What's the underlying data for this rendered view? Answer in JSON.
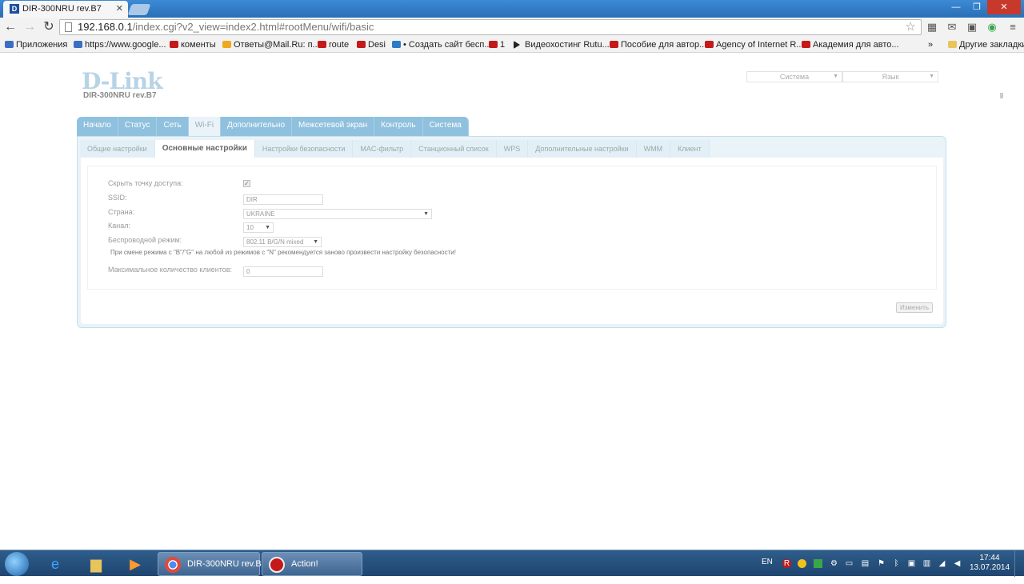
{
  "browser": {
    "tab_title": "DIR-300NRU rev.B7",
    "tab_favicon_letter": "D",
    "url_host": "192.168.0.1",
    "url_path": "/index.cgi?v2_view=index2.html#rootMenu/wifi/basic"
  },
  "bookmarks": [
    {
      "label": "Приложения",
      "icon": "apps-grid-icon"
    },
    {
      "label": "https://www.google...",
      "icon": "google-icon"
    },
    {
      "label": "коменты",
      "icon": "youtube-icon"
    },
    {
      "label": "Ответы@Mail.Ru: п...",
      "icon": "mail-answers-icon"
    },
    {
      "label": "route",
      "icon": "youtube-icon"
    },
    {
      "label": "Desi",
      "icon": "youtube-icon"
    },
    {
      "label": "• Создать сайт бесп...",
      "icon": "jimdo-icon"
    },
    {
      "label": "1",
      "icon": "youtube-icon"
    },
    {
      "label": "Видеохостинг Rutu...",
      "icon": "play-icon"
    },
    {
      "label": "Пособие для автор...",
      "icon": "youtube-icon"
    },
    {
      "label": "Agency of Internet R...",
      "icon": "youtube-icon"
    },
    {
      "label": "Академия для авто...",
      "icon": "youtube-icon"
    }
  ],
  "bookmarks_overflow": "»",
  "other_bookmarks": "Другие закладки",
  "router": {
    "logo": "D-Link",
    "model": "DIR-300NRU rev.B7",
    "system_select": "Система",
    "language_select": "Язык",
    "top_nav": [
      "Начало",
      "Статус",
      "Сеть",
      "Wi-Fi",
      "Дополнительно",
      "Межсетевой экран",
      "Контроль",
      "Система"
    ],
    "top_nav_active": "Wi-Fi",
    "sub_nav": [
      "Общие настройки",
      "Основные настройки",
      "Настройки безопасности",
      "MAC-фильтр",
      "Станционный список",
      "WPS",
      "Дополнительные настройки",
      "WMM",
      "Клиент"
    ],
    "sub_nav_active": "Основные настройки",
    "form": {
      "hide_ap_label": "Скрыть точку доступа:",
      "hide_ap_checked": true,
      "ssid_label": "SSID:",
      "ssid_value": "DIR",
      "country_label": "Страна:",
      "country_value": "UKRAINE",
      "channel_label": "Канал:",
      "channel_value": "10",
      "mode_label": "Беспроводной режим:",
      "mode_value": "802.11 B/G/N mixed",
      "mode_note": "При смене режима с \"B\"/\"G\" на любой из режимов с \"N\" рекомендуется заново произвести настройку безопасности!",
      "max_clients_label": "Максимальное количество клиентов:",
      "max_clients_value": "0",
      "apply_button": "Изменить"
    }
  },
  "taskbar": {
    "task_chrome": "DIR-300NRU rev.B...",
    "task_action": "Action!",
    "lang": "EN",
    "time": "17:44",
    "date": "13.07.2014"
  }
}
